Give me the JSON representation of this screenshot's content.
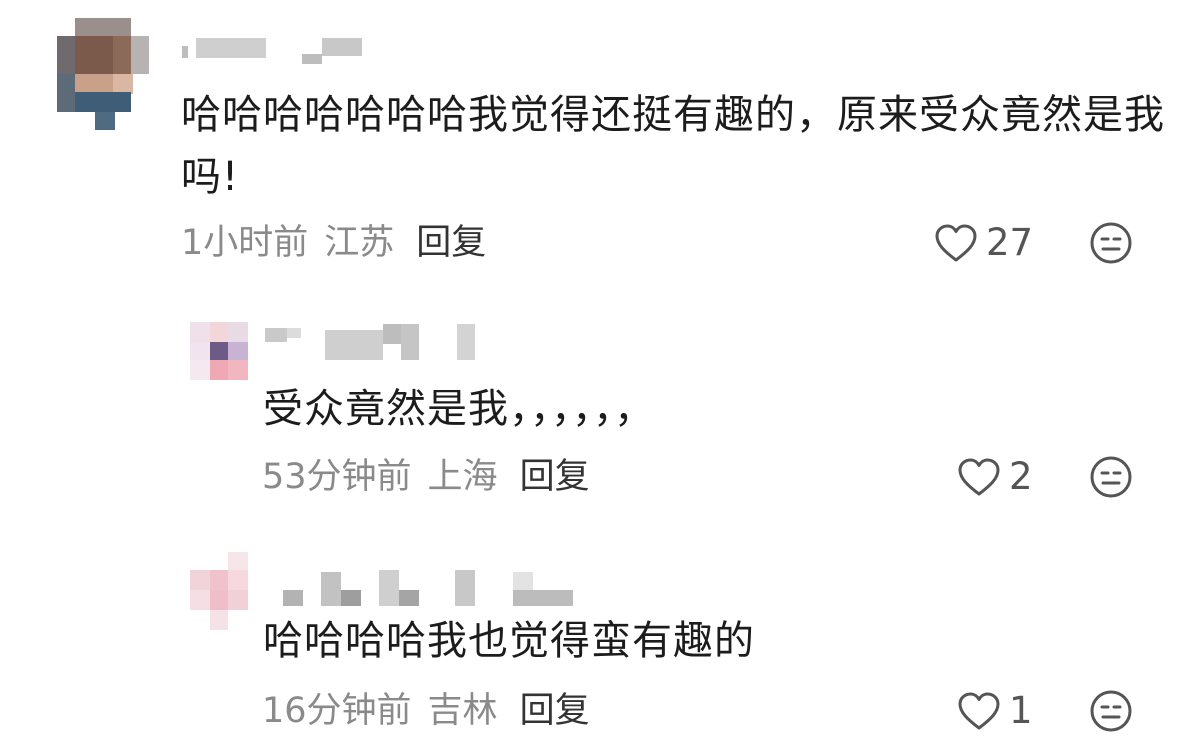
{
  "comments": [
    {
      "text": "哈哈哈哈哈哈哈我觉得还挺有趣的，原来受众竟然是我吗!",
      "time": "1小时前",
      "location": "江苏",
      "reply_label": "回复",
      "likes": "27",
      "avatar": "blurred-avatar"
    },
    {
      "text": "受众竟然是我，，，，，，",
      "time": "53分钟前",
      "location": "上海",
      "reply_label": "回复",
      "likes": "2",
      "avatar": "blurred-avatar"
    },
    {
      "text": "哈哈哈哈我也觉得蛮有趣的",
      "time": "16分钟前",
      "location": "吉林",
      "reply_label": "回复",
      "likes": "1",
      "avatar": "blurred-avatar"
    }
  ],
  "icons": {
    "like": "heart-outline-icon",
    "dislike": "meh-face-icon"
  },
  "colors": {
    "text": "#1c1c1c",
    "meta": "#8a8a8a",
    "reply": "#333333",
    "icon": "#555555"
  }
}
